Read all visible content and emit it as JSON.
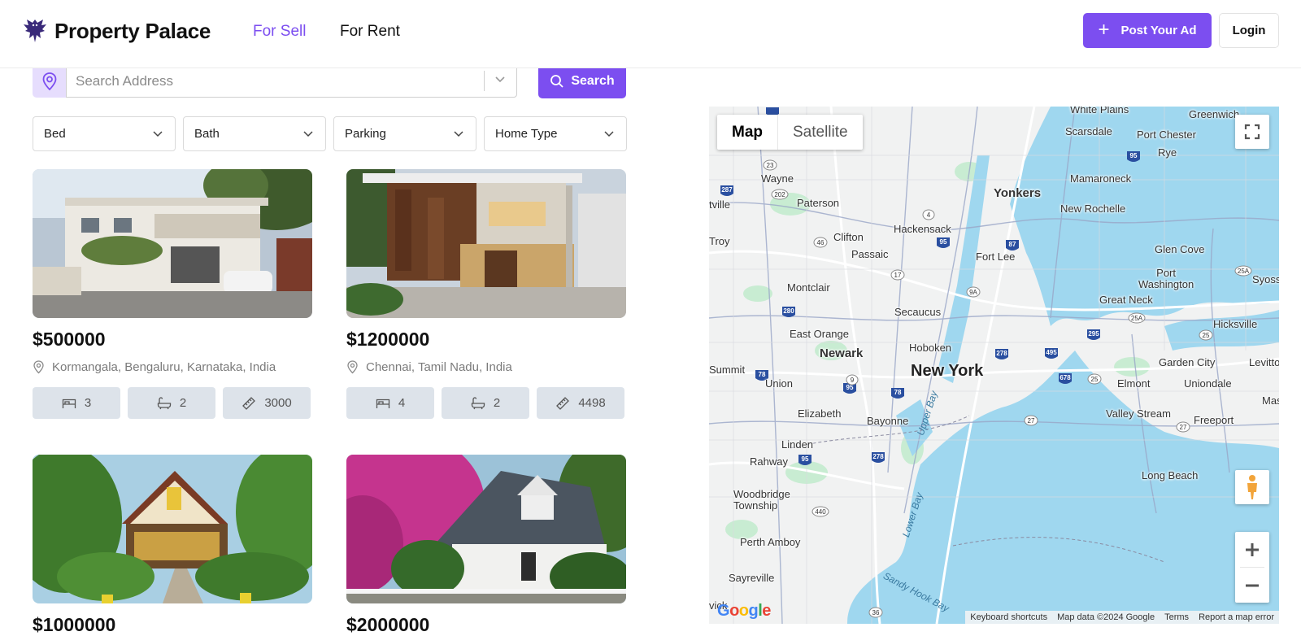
{
  "header": {
    "brand": "Property Palace",
    "nav": [
      {
        "label": "For Sell",
        "active": true
      },
      {
        "label": "For Rent",
        "active": false
      }
    ],
    "post_ad_label": "Post Your Ad",
    "login_label": "Login"
  },
  "search": {
    "placeholder": "Search Address",
    "button_label": "Search"
  },
  "filters": [
    {
      "label": "Bed"
    },
    {
      "label": "Bath"
    },
    {
      "label": "Parking"
    },
    {
      "label": "Home Type"
    }
  ],
  "listings": [
    {
      "price": "$500000",
      "address": "Kormangala, Bengaluru, Karnataka, India",
      "beds": "3",
      "baths": "2",
      "area": "3000"
    },
    {
      "price": "$1200000",
      "address": "Chennai, Tamil Nadu, India",
      "beds": "4",
      "baths": "2",
      "area": "4498"
    },
    {
      "price": "$1000000",
      "address": "",
      "beds": "",
      "baths": "",
      "area": ""
    },
    {
      "price": "$2000000",
      "address": "",
      "beds": "",
      "baths": "",
      "area": ""
    }
  ],
  "map": {
    "type_map_label": "Map",
    "type_satellite_label": "Satellite",
    "footer": {
      "shortcuts": "Keyboard shortcuts",
      "data": "Map data ©2024 Google",
      "terms": "Terms",
      "report": "Report a map error"
    },
    "labels": {
      "new_york": "New York",
      "newark": "Newark",
      "yonkers": "Yonkers",
      "white_plains": "White Plains",
      "greenwich": "Greenwich",
      "scarsdale": "Scarsdale",
      "port_chester": "Port Chester",
      "rye": "Rye",
      "mamaroneck": "Mamaroneck",
      "wayne": "Wayne",
      "paterson": "Paterson",
      "hackensack": "Hackensack",
      "new_rochelle": "New Rochelle",
      "clifton": "Clifton",
      "passaic": "Passaic",
      "fort_lee": "Fort Lee",
      "glen_cove": "Glen Cove",
      "port_washington": "Port\nWashington",
      "montclair": "Montclair",
      "secaucus": "Secaucus",
      "great_neck": "Great Neck",
      "syosset": "Syoss",
      "hicksville": "Hicksville",
      "east_orange": "East Orange",
      "hoboken": "Hoboken",
      "garden_city": "Garden City",
      "levittown": "Levittow",
      "summit": "Summit",
      "union": "Union",
      "elmont": "Elmont",
      "uniondale": "Uniondale",
      "mas": "Mas",
      "elizabeth": "Elizabeth",
      "bayonne": "Bayonne",
      "valley_stream": "Valley Stream",
      "freeport": "Freeport",
      "linden": "Linden",
      "rahway": "Rahway",
      "long_beach": "Long Beach",
      "woodbridge": "Woodbridge\nTownship",
      "perth_amboy": "Perth Amboy",
      "sayreville": "Sayreville",
      "upper_bay": "Upper Bay",
      "lower_bay": "Lower Bay",
      "sandy_hook": "Sandy Hook Bay",
      "troy": "Troy",
      "tville": "tville",
      "vick": "vick"
    }
  },
  "colors": {
    "accent": "#7c4ef0",
    "accent_light": "#e6ddfd",
    "feature_bg": "#dde3ea",
    "water": "#9fd7ef",
    "park": "#c8ecd2"
  }
}
